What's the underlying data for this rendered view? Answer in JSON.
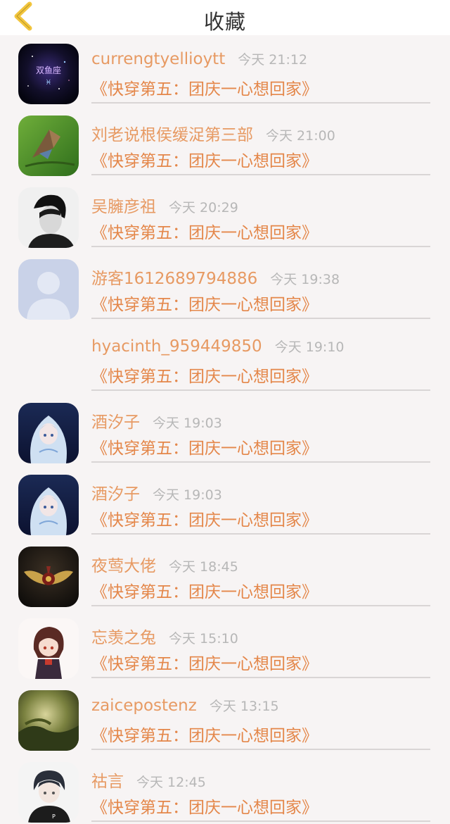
{
  "header": {
    "title": "收藏",
    "back_icon": "chevron-left-icon",
    "accent": "#f2c53d"
  },
  "colors": {
    "name": "#e79a63",
    "book": "#e4874a",
    "time": "#b7b7b7",
    "background": "#f7f4f4"
  },
  "items": [
    {
      "name": "currengtyellioytt",
      "time": "今天 21:12",
      "book": "《快穿第五：团庆一心想回家》",
      "avatar": "pisces-galaxy-avatar",
      "avatar_text": "双鱼座"
    },
    {
      "name": "刘老说根侯缓浞第三部",
      "time": "今天 21:00",
      "book": "《快穿第五：团庆一心想回家》",
      "avatar": "butterfly-avatar"
    },
    {
      "name": "吴臃彦祖",
      "time": "今天 20:29",
      "book": "《快穿第五：团庆一心想回家》",
      "avatar": "portrait-man-avatar"
    },
    {
      "name": "游客1612689794886",
      "time": "今天 19:38",
      "book": "《快穿第五：团庆一心想回家》",
      "avatar": "default-user-avatar"
    },
    {
      "name": "hyacinth_959449850",
      "time": "今天 19:10",
      "book": "《快穿第五：团庆一心想回家》",
      "avatar": "none"
    },
    {
      "name": "酒汐子",
      "time": "今天 19:03",
      "book": "《快穿第五：团庆一心想回家》",
      "avatar": "anime-girl-avatar"
    },
    {
      "name": "酒汐子",
      "time": "今天 19:03",
      "book": "《快穿第五：团庆一心想回家》",
      "avatar": "anime-girl-avatar"
    },
    {
      "name": "夜莺大佬",
      "time": "今天 18:45",
      "book": "《快穿第五：团庆一心想回家》",
      "avatar": "winged-emblem-avatar"
    },
    {
      "name": "忘羡之兔",
      "time": "今天 15:10",
      "book": "《快穿第五：团庆一心想回家》",
      "avatar": "chibi-character-avatar"
    },
    {
      "name": "zaicepostenz",
      "time": "今天 13:15",
      "book": "《快穿第五：团庆一心想回家》",
      "avatar": "misty-landscape-avatar"
    },
    {
      "name": "祜言",
      "time": "今天 12:45",
      "book": "《快穿第五：团庆一心想回家》",
      "avatar": "anime-boy-avatar"
    }
  ]
}
